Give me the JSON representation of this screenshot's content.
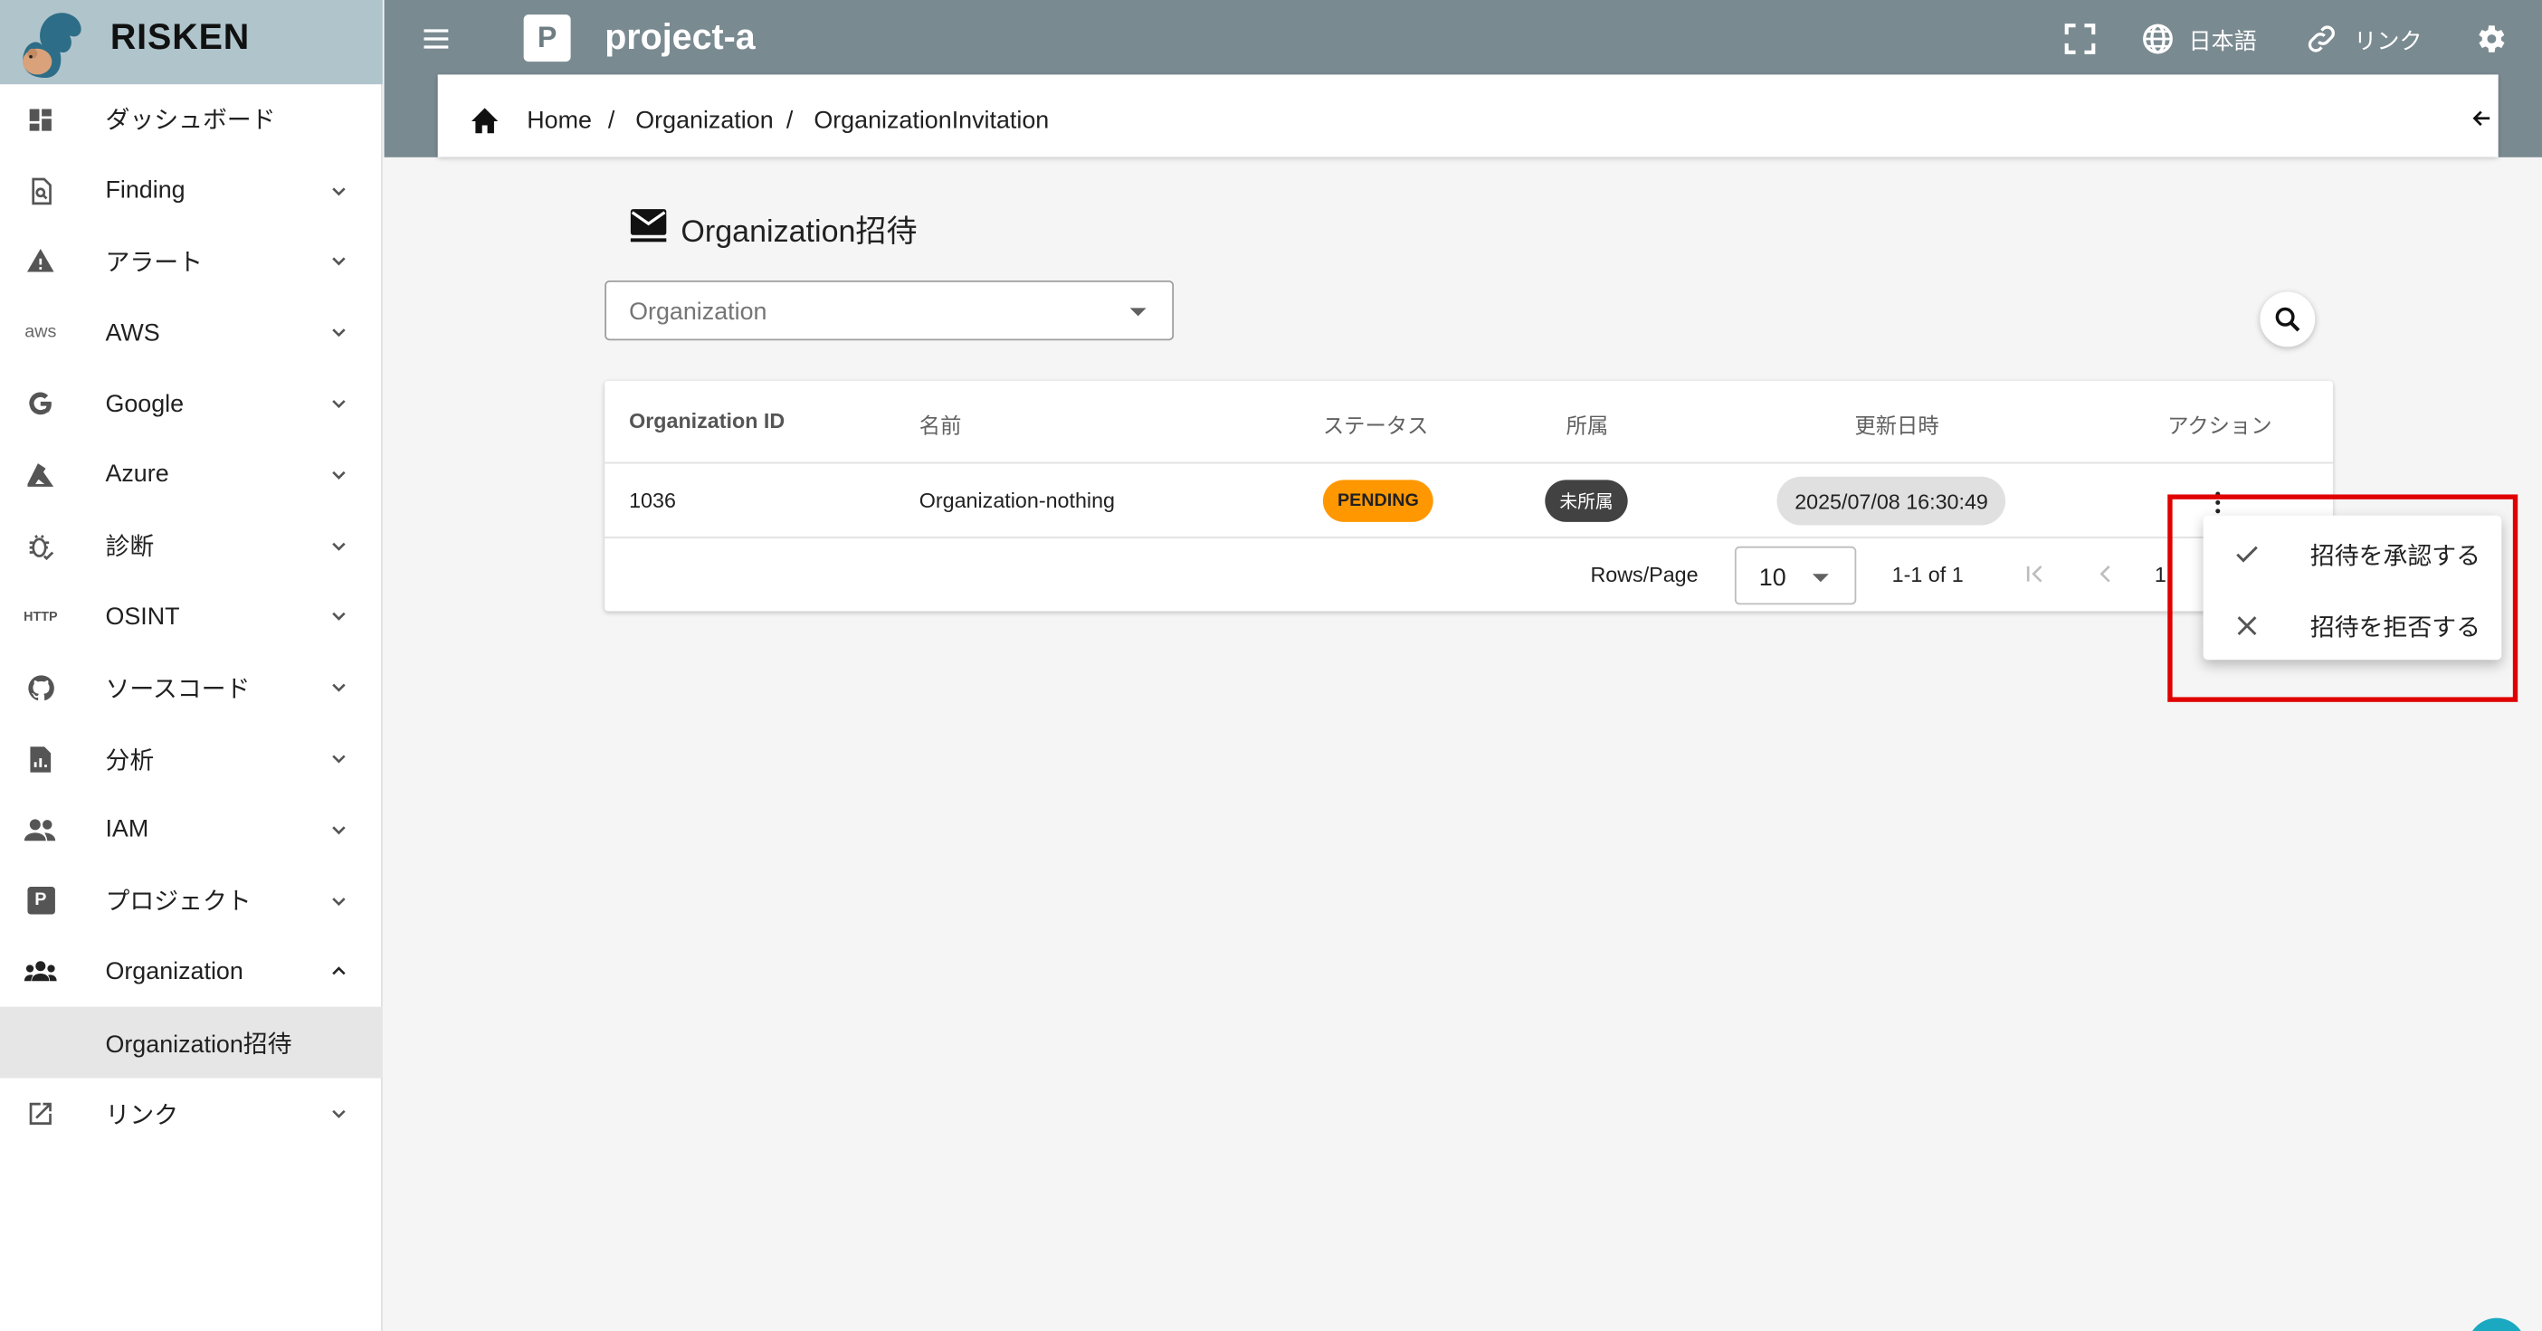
{
  "brand": {
    "name": "RISKEN"
  },
  "header": {
    "project_badge": "P",
    "project_name": "project-a",
    "language": "日本語",
    "link_label": "リンク"
  },
  "sidebar": {
    "items": [
      {
        "label": "ダッシュボード",
        "icon": "dashboard-icon"
      },
      {
        "label": "Finding",
        "icon": "finding-icon"
      },
      {
        "label": "アラート",
        "icon": "alert-icon"
      },
      {
        "label": "AWS",
        "icon": "aws-icon"
      },
      {
        "label": "Google",
        "icon": "google-icon"
      },
      {
        "label": "Azure",
        "icon": "azure-icon"
      },
      {
        "label": "診断",
        "icon": "bug-icon"
      },
      {
        "label": "OSINT",
        "icon": "http-icon"
      },
      {
        "label": "ソースコード",
        "icon": "github-icon"
      },
      {
        "label": "分析",
        "icon": "analysis-icon"
      },
      {
        "label": "IAM",
        "icon": "people-icon"
      },
      {
        "label": "プロジェクト",
        "icon": "project-icon"
      },
      {
        "label": "Organization",
        "icon": "groups-icon",
        "expanded": true
      },
      {
        "label": "Organization招待",
        "sub": true,
        "active": true
      },
      {
        "label": "リンク",
        "icon": "external-link-icon"
      }
    ],
    "aws_icon_text": "aws",
    "osint_icon_text": "HTTP"
  },
  "breadcrumb": [
    "Home",
    "Organization",
    "OrganizationInvitation"
  ],
  "page": {
    "title": "Organization招待",
    "org_select": {
      "value": "Organization"
    }
  },
  "table": {
    "columns": [
      "Organization ID",
      "名前",
      "ステータス",
      "所属",
      "更新日時",
      "アクション"
    ],
    "rows": [
      {
        "id": "1036",
        "name": "Organization-nothing",
        "status": "PENDING",
        "affiliation": "未所属",
        "updated_at": "2025/07/08 16:30:49"
      }
    ],
    "pagination": {
      "rows_per_page_label": "Rows/Page",
      "rows_per_page": "10",
      "range": "1-1 of 1",
      "page": "1"
    }
  },
  "action_menu": {
    "items": [
      {
        "label": "招待を承認する",
        "icon": "check-icon"
      },
      {
        "label": "招待を拒否する",
        "icon": "close-icon"
      }
    ]
  },
  "colors": {
    "topbar": "#7a8a91",
    "brand_bg": "#b0c4cc",
    "pending": "#ff9800",
    "highlight": "#e00000",
    "active_item": "#e6e6e6"
  }
}
